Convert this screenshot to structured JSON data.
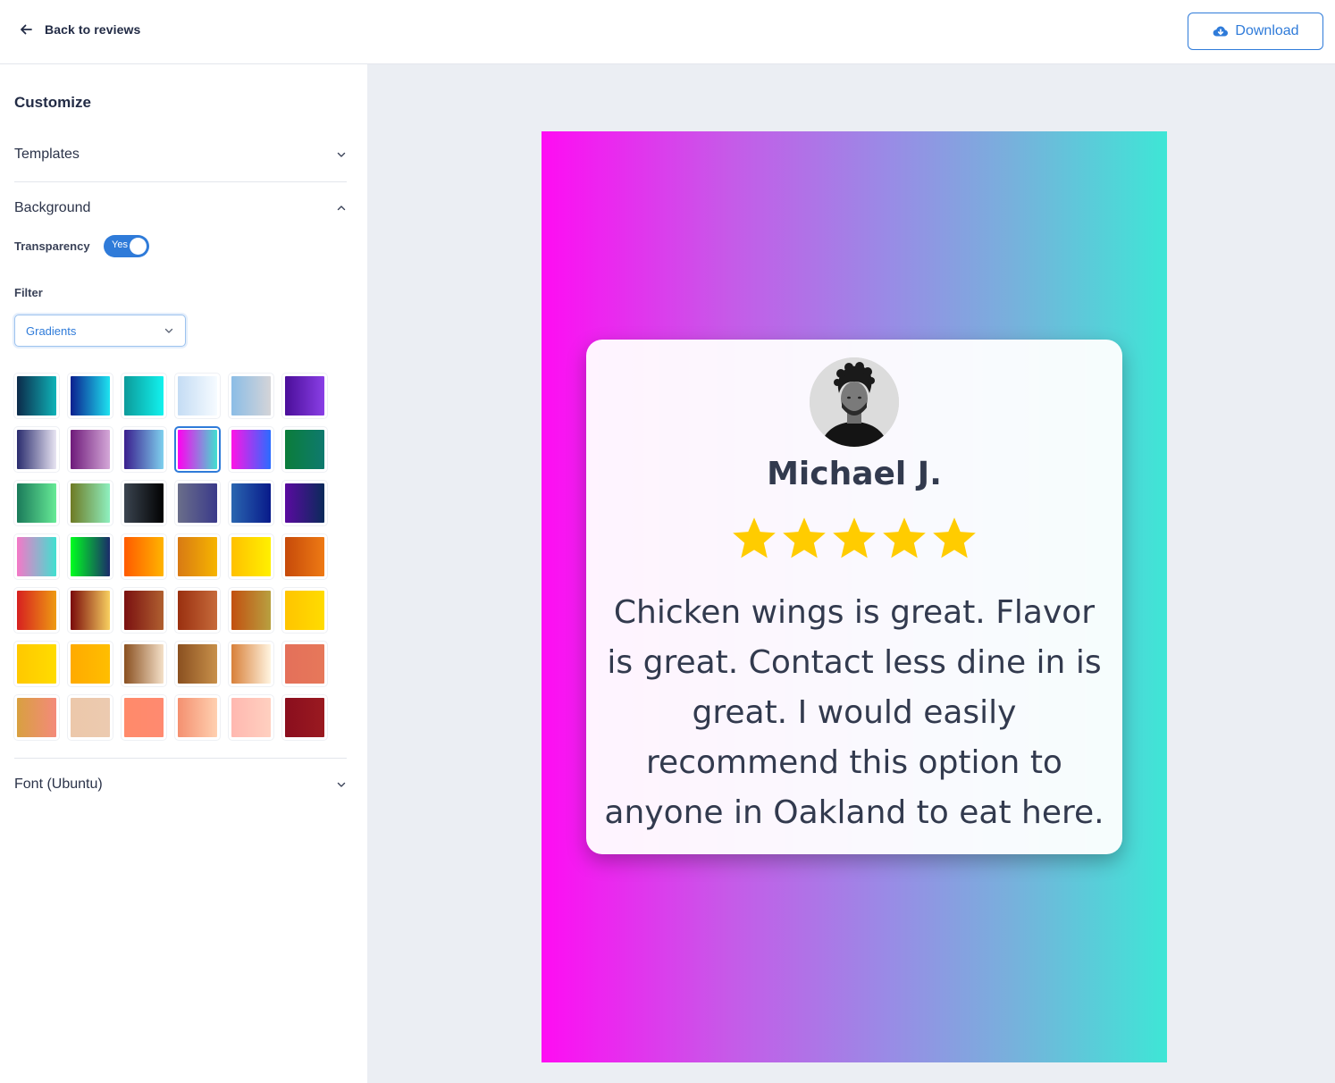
{
  "header": {
    "back_label": "Back to reviews",
    "download_label": "Download"
  },
  "sidebar": {
    "title": "Customize",
    "templates_label": "Templates",
    "background_label": "Background",
    "transparency_label": "Transparency",
    "transparency_value": "Yes",
    "filter_label": "Filter",
    "filter_value": "Gradients",
    "font_label": "Font (Ubuntu)",
    "selected_swatch": 9,
    "swatches": [
      "linear-gradient(90deg,#0c2a4a,#0fb3b8)",
      "linear-gradient(90deg,#0b1f8f,#1ee3f0)",
      "linear-gradient(90deg,#0c9a9a,#12f2ee)",
      "linear-gradient(90deg,#c4dcf4,#f6fbff)",
      "linear-gradient(90deg,#8bbde6,#d4d4d8)",
      "linear-gradient(90deg,#4a0e99,#8a3fe6)",
      "linear-gradient(90deg,#2a2c6e,#e8e4f2)",
      "linear-gradient(90deg,#6e1a7a,#d4a8d8)",
      "linear-gradient(90deg,#3a1e8e,#7ed0ee)",
      "linear-gradient(90deg,#ff00f0,#40e0d0)",
      "linear-gradient(90deg,#ff14e6,#2a6cff)",
      "linear-gradient(90deg,#0b7d3a,#0e7a6e)",
      "linear-gradient(90deg,#1a7a5a,#66ea96)",
      "linear-gradient(90deg,#6e7a24,#8ef0c0)",
      "linear-gradient(90deg,#3a4450,#020202)",
      "linear-gradient(90deg,#6a6e8a,#3a3a8a)",
      "linear-gradient(90deg,#2a66b0,#081a8a)",
      "linear-gradient(90deg,#5a0aa0,#0a2a5a)",
      "linear-gradient(90deg,#f478c8,#40e0d0)",
      "linear-gradient(90deg,#00ff20,#1a2a6a)",
      "linear-gradient(90deg,#ff5a00,#ffb400)",
      "linear-gradient(90deg,#d87a14,#f6b400)",
      "linear-gradient(90deg,#ffc000,#fff000)",
      "linear-gradient(90deg,#c64a0a,#ee7a14)",
      "linear-gradient(90deg,#d62020,#ee9a12)",
      "linear-gradient(90deg,#7a0a0a,#f8d060)",
      "linear-gradient(90deg,#7a1010,#b06030)",
      "linear-gradient(90deg,#9a3010,#c66a3a)",
      "linear-gradient(90deg,#c25010,#b8a040)",
      "linear-gradient(90deg,#ffc400,#ffdc00)",
      "linear-gradient(90deg,#ffc800,#ffdc00)",
      "linear-gradient(90deg,#ffaa00,#ffbe00)",
      "linear-gradient(90deg,#8a5020,#f4e0c8)",
      "linear-gradient(90deg,#8a5020,#c8904a)",
      "linear-gradient(90deg,#d8803a,#fff4e0)",
      "linear-gradient(90deg,#e4705a,#e6785a)",
      "linear-gradient(90deg,#d8a040,#f48a7a)",
      "linear-gradient(90deg,#ecc8aa,#eccab0)",
      "linear-gradient(90deg,#ff8a6a,#ff8a70)",
      "linear-gradient(90deg,#f49070,#ffd0b0)",
      "linear-gradient(90deg,#ffb8b0,#ffd0c0)",
      "linear-gradient(90deg,#8a0e1e,#9a1a20)"
    ]
  },
  "preview": {
    "background": "linear-gradient(90deg,#ff0cf3 0%,#c65ae8 30%,#9a8ae6 55%,#78b0dc 75%,#3ee6d6 100%)",
    "reviewer_name": "Michael J.",
    "rating": 5,
    "rating_max": 5,
    "star_color": "#ffcc00",
    "review_text": "Chicken wings is great. Flavor is great. Contact less dine in is great. I would easily recommend this option to anyone in Oakland to eat here."
  },
  "icons": {
    "back": "arrow-left-icon",
    "download": "cloud-download-icon",
    "templates_chevron": "chevron-down-icon",
    "background_chevron": "chevron-up-icon",
    "select_chevron": "chevron-down-icon",
    "font_chevron": "chevron-down-icon",
    "star": "star-icon"
  },
  "colors": {
    "accent": "#2f7bd9",
    "text": "#222b45"
  }
}
